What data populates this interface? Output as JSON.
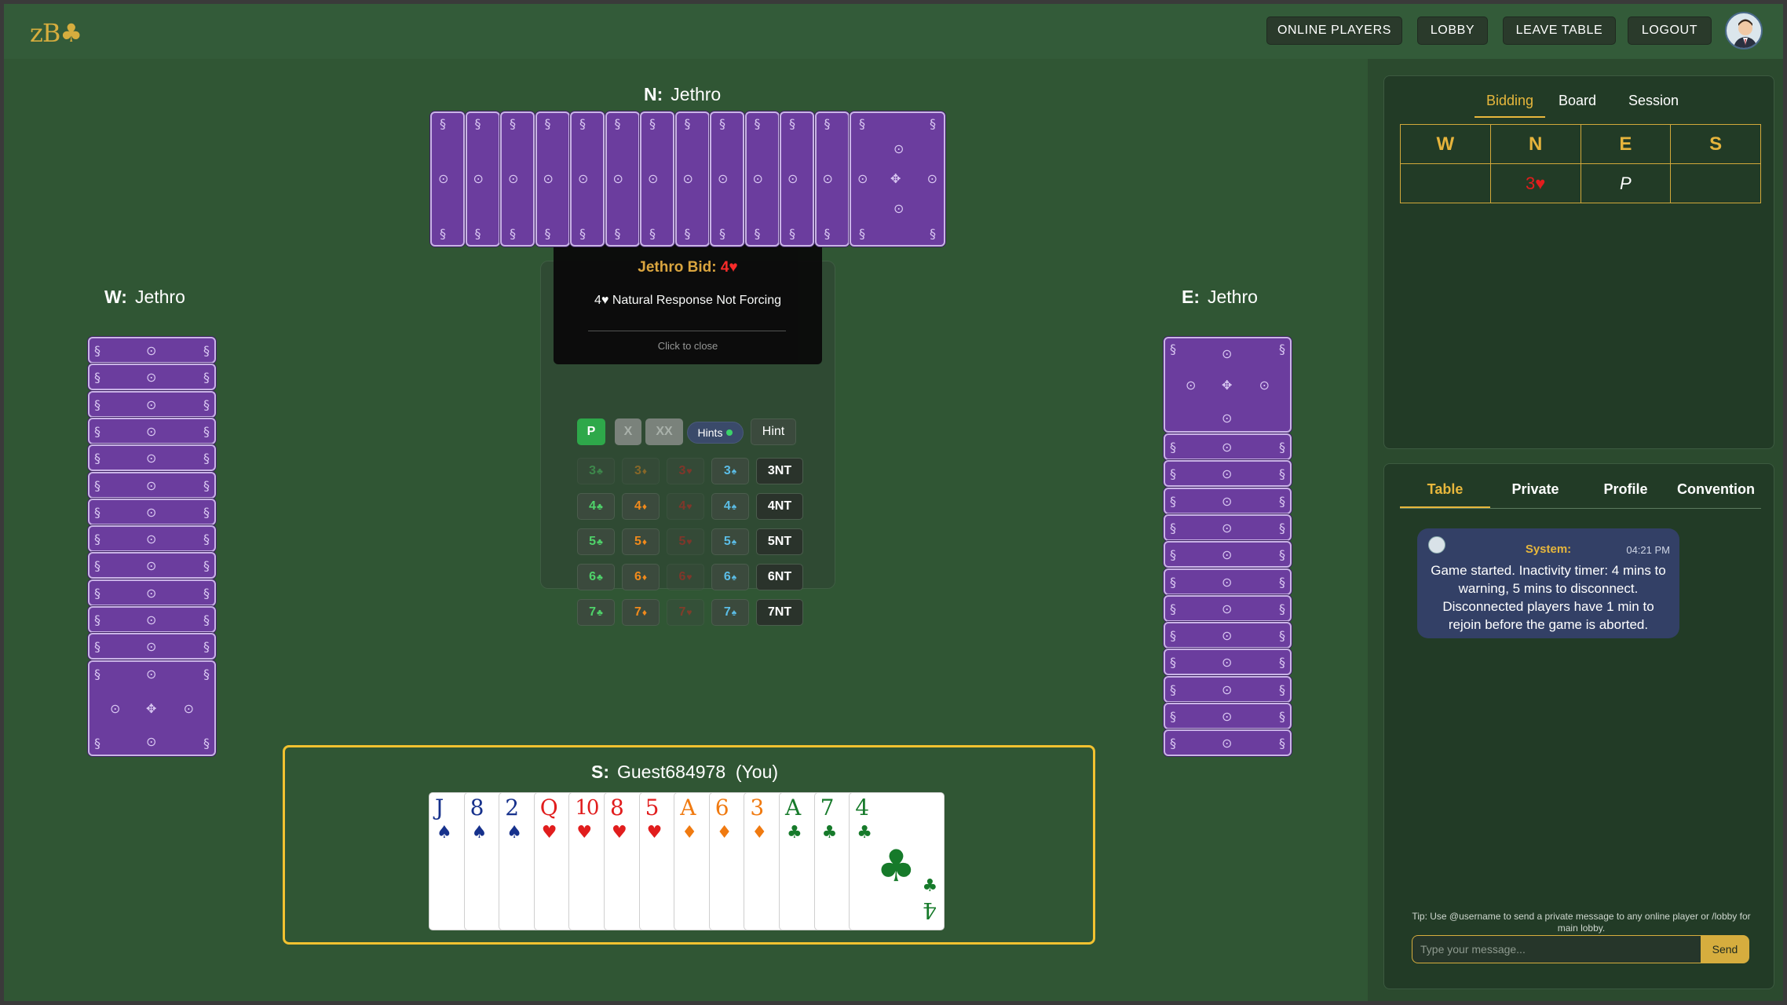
{
  "app": {
    "logo": "zB♣"
  },
  "nav": {
    "online_players": "ONLINE PLAYERS",
    "lobby": "LOBBY",
    "leave_table": "LEAVE TABLE",
    "logout": "LOGOUT"
  },
  "seats": {
    "north": {
      "dir": "N:",
      "name": "Jethro",
      "cards": 13
    },
    "west": {
      "dir": "W:",
      "name": "Jethro",
      "cards": 13
    },
    "east": {
      "dir": "E:",
      "name": "Jethro",
      "cards": 13
    },
    "south": {
      "dir": "S:",
      "name": "Guest684978",
      "you": "(You)"
    }
  },
  "tooltip": {
    "title_prefix": "Jethro Bid: ",
    "title_bid": "4♥",
    "description": "4♥ Natural Response  Not Forcing",
    "close": "Click to close"
  },
  "bid_controls": {
    "pass": "P",
    "double": "X",
    "redouble": "XX",
    "hints": "Hints",
    "hint": "Hint",
    "rows": [
      {
        "level": "3",
        "nt": "3NT",
        "dim": [
          true,
          true,
          true,
          false,
          false
        ]
      },
      {
        "level": "4",
        "nt": "4NT",
        "dim": [
          false,
          false,
          true,
          false,
          false
        ]
      },
      {
        "level": "5",
        "nt": "5NT",
        "dim": [
          false,
          false,
          true,
          false,
          false
        ]
      },
      {
        "level": "6",
        "nt": "6NT",
        "dim": [
          false,
          false,
          true,
          false,
          false
        ]
      },
      {
        "level": "7",
        "nt": "7NT",
        "dim": [
          false,
          false,
          true,
          false,
          false
        ]
      }
    ],
    "suits": [
      "♣",
      "♦",
      "♥",
      "♠"
    ]
  },
  "south_hand": [
    {
      "rank": "J",
      "suit": "♠"
    },
    {
      "rank": "8",
      "suit": "♠"
    },
    {
      "rank": "2",
      "suit": "♠"
    },
    {
      "rank": "Q",
      "suit": "♥"
    },
    {
      "rank": "10",
      "suit": "♥"
    },
    {
      "rank": "8",
      "suit": "♥"
    },
    {
      "rank": "5",
      "suit": "♥"
    },
    {
      "rank": "A",
      "suit": "♦"
    },
    {
      "rank": "6",
      "suit": "♦"
    },
    {
      "rank": "3",
      "suit": "♦"
    },
    {
      "rank": "A",
      "suit": "♣"
    },
    {
      "rank": "7",
      "suit": "♣"
    },
    {
      "rank": "4",
      "suit": "♣"
    }
  ],
  "colors": {
    "clubs": "#4fd36a",
    "diamonds": "#f08a1c",
    "hearts": "#e02020",
    "spades": "#5bbde6",
    "card_spades": "#16318c",
    "card_hearts": "#e11d1d",
    "card_diamonds": "#f07a10",
    "card_clubs": "#167a2a",
    "accent": "#e7b73c"
  },
  "bidding_panel": {
    "tabs": [
      "Bidding",
      "Board",
      "Session"
    ],
    "active_tab": "Bidding",
    "columns": [
      "W",
      "N",
      "E",
      "S"
    ],
    "rows": [
      [
        "",
        "3♥",
        "P",
        ""
      ]
    ]
  },
  "chat_panel": {
    "tabs": [
      "Table",
      "Private",
      "Profile",
      "Convention"
    ],
    "active_tab": "Table",
    "message": {
      "sender": "System:",
      "time": "04:21 PM",
      "text": "Game started. Inactivity timer: 4 mins to warning, 5 mins to disconnect. Disconnected players have 1 min to rejoin before the game is aborted."
    },
    "tip": "Tip: Use @username to send a private message to any online player or /lobby for main lobby.",
    "input_placeholder": "Type your message...",
    "send": "Send"
  }
}
